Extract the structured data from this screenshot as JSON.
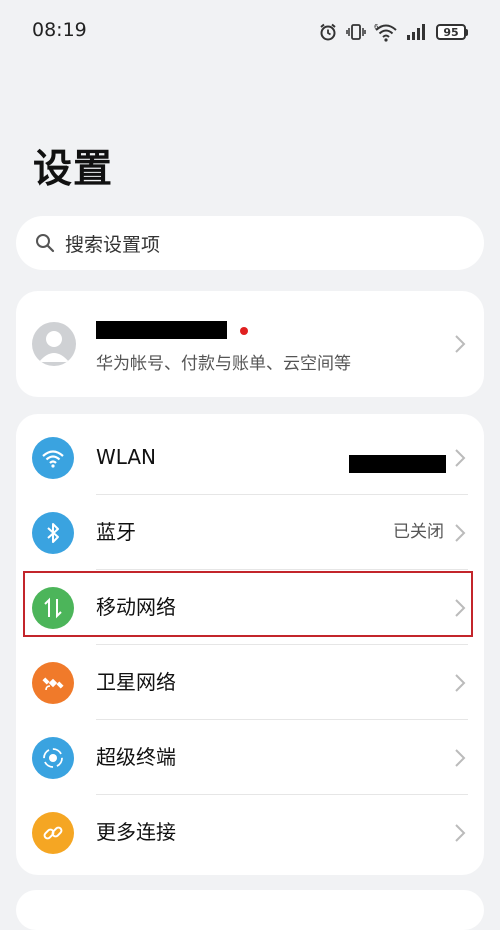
{
  "status_bar": {
    "time": "08:19",
    "battery": "95"
  },
  "page": {
    "title": "设置"
  },
  "search": {
    "placeholder": "搜索设置项"
  },
  "account": {
    "subtitle": "华为帐号、付款与账单、云空间等"
  },
  "settings_list": [
    {
      "label": "WLAN",
      "value": "",
      "icon": "wifi-icon",
      "color": "#3aa3e0"
    },
    {
      "label": "蓝牙",
      "value": "已关闭",
      "icon": "bluetooth-icon",
      "color": "#3aa3e0"
    },
    {
      "label": "移动网络",
      "value": "",
      "icon": "mobile-data-icon",
      "color": "#4cb55a"
    },
    {
      "label": "卫星网络",
      "value": "",
      "icon": "satellite-icon",
      "color": "#f07a2a"
    },
    {
      "label": "超级终端",
      "value": "",
      "icon": "super-device-icon",
      "color": "#3aa3e0"
    },
    {
      "label": "更多连接",
      "value": "",
      "icon": "link-icon",
      "color": "#f5a623"
    }
  ],
  "colors": {
    "background": "#f1f2f4",
    "card": "#ffffff",
    "highlight": "#c3252b"
  }
}
